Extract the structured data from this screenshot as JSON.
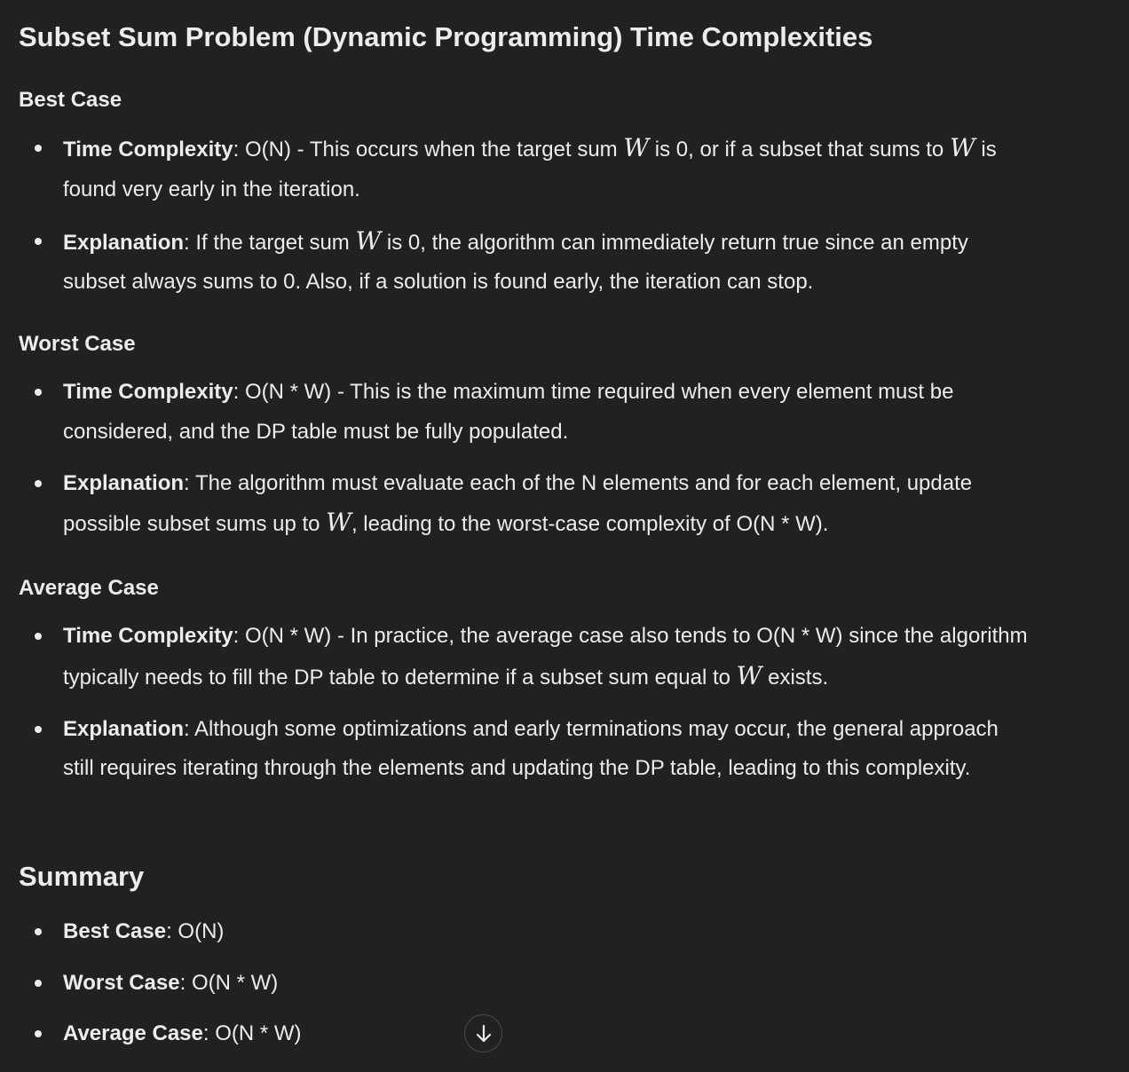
{
  "title": "Subset Sum Problem (Dynamic Programming) Time Complexities",
  "sections": [
    {
      "heading": "Best Case",
      "items": [
        {
          "label": "Time Complexity",
          "sep": ": ",
          "parts": [
            "O(N) - This occurs when the target sum ",
            "W",
            " is 0, or if a subset that sums to ",
            "W",
            " is found very early in the iteration."
          ]
        },
        {
          "label": "Explanation",
          "sep": ": ",
          "parts": [
            "If the target sum ",
            "W",
            " is 0, the algorithm can immediately return true since an empty subset always sums to 0. Also, if a solution is found early, the iteration can stop."
          ]
        }
      ]
    },
    {
      "heading": "Worst Case",
      "items": [
        {
          "label": "Time Complexity",
          "sep": ": ",
          "parts": [
            "O(N * W) - This is the maximum time required when every element must be considered, and the DP table must be fully populated."
          ]
        },
        {
          "label": "Explanation",
          "sep": ": ",
          "parts": [
            "The algorithm must evaluate each of the N elements and for each element, update possible subset sums up to ",
            "W",
            ", leading to the worst-case complexity of O(N * W)."
          ]
        }
      ]
    },
    {
      "heading": "Average Case",
      "items": [
        {
          "label": "Time Complexity",
          "sep": ": ",
          "parts": [
            "O(N * W) - In practice, the average case also tends to O(N * W) since the algorithm typically needs to fill the DP table to determine if a subset sum equal to ",
            "W",
            " exists."
          ]
        },
        {
          "label": "Explanation",
          "sep": ": ",
          "parts": [
            "Although some optimizations and early terminations may occur, the general approach still requires iterating through the elements and updating the DP table, leading to this complexity."
          ]
        }
      ]
    }
  ],
  "summary": {
    "heading": "Summary",
    "items": [
      {
        "label": "Best Case",
        "sep": ": ",
        "value": "O(N)"
      },
      {
        "label": "Worst Case",
        "sep": ": ",
        "value": "O(N * W)"
      },
      {
        "label": "Average Case",
        "sep": ": ",
        "value": "O(N * W)"
      }
    ]
  },
  "scroll_button": {
    "icon": "arrow-down-icon"
  }
}
